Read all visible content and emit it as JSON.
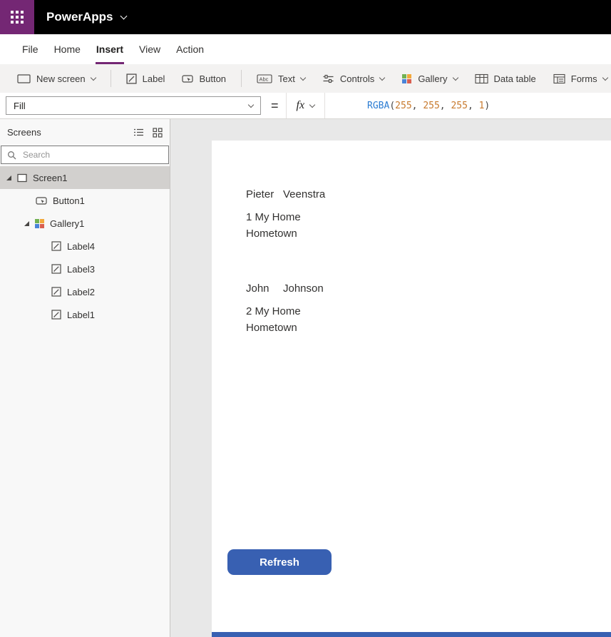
{
  "colors": {
    "brand_purple": "#742774",
    "topbar_black": "#000000",
    "primary_button_blue": "#3860b2",
    "formula_function_blue": "#2b7cd3",
    "formula_number_orange": "#c87a2e"
  },
  "topbar": {
    "app_title": "PowerApps"
  },
  "menu": {
    "items": [
      {
        "label": "File",
        "active": false
      },
      {
        "label": "Home",
        "active": false
      },
      {
        "label": "Insert",
        "active": true
      },
      {
        "label": "View",
        "active": false
      },
      {
        "label": "Action",
        "active": false
      }
    ]
  },
  "ribbon": {
    "new_screen": "New screen",
    "label": "Label",
    "button": "Button",
    "text": "Text",
    "controls": "Controls",
    "gallery": "Gallery",
    "data_table": "Data table",
    "forms": "Forms",
    "text_icon_glyph": "Abc"
  },
  "formula_bar": {
    "property": "Fill",
    "equals": "=",
    "fx_label": "fx",
    "formula": "RGBA(255, 255, 255, 1)",
    "tokens": [
      "RGBA",
      "(",
      "255",
      ", ",
      "255",
      ", ",
      "255",
      ", ",
      "1",
      ")"
    ]
  },
  "sidebar": {
    "title": "Screens",
    "search_placeholder": "Search",
    "tree": [
      {
        "label": "Screen1",
        "type": "screen",
        "selected": true,
        "expanded": true
      },
      {
        "label": "Button1",
        "type": "button"
      },
      {
        "label": "Gallery1",
        "type": "gallery",
        "expanded": true
      },
      {
        "label": "Label4",
        "type": "label"
      },
      {
        "label": "Label3",
        "type": "label"
      },
      {
        "label": "Label2",
        "type": "label"
      },
      {
        "label": "Label1",
        "type": "label"
      }
    ]
  },
  "canvas": {
    "gallery": [
      {
        "first": "Pieter",
        "last": "Veenstra",
        "line2": "1 My Home",
        "line3": "Hometown"
      },
      {
        "first": "John",
        "last": "Johnson",
        "line2": "2 My Home",
        "line3": "Hometown"
      }
    ],
    "refresh_label": "Refresh"
  }
}
